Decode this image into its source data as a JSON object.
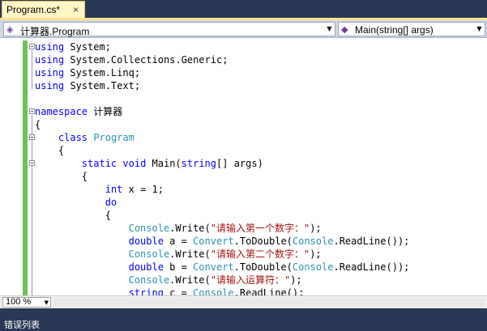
{
  "tab": {
    "title": "Program.cs*",
    "close": "×"
  },
  "navigation": {
    "type_combo": {
      "icon": "class-icon",
      "icon_glyph": "◈",
      "value": "计算器.Program",
      "arrow": "▼"
    },
    "member_combo": {
      "icon": "method-icon",
      "icon_glyph": "◆",
      "value": "Main(string[] args)",
      "arrow": "▼"
    }
  },
  "code": {
    "l1": {
      "kw": "using",
      "rest": " System;"
    },
    "l2": {
      "kw": "using",
      "rest": " System.Collections.Generic;"
    },
    "l3": {
      "kw": "using",
      "rest": " System.Linq;"
    },
    "l4": {
      "kw": "using",
      "rest": " System.Text;"
    },
    "l6": {
      "kw": "namespace",
      "rest": " 计算器"
    },
    "l7": {
      "text": "{"
    },
    "l8": {
      "indent": "    ",
      "kw": "class",
      "ty": "Program"
    },
    "l9": {
      "text": "    {"
    },
    "l10": {
      "indent": "        ",
      "kw1": "static",
      "kw2": "void",
      "name": "Main(",
      "kw3": "string",
      "rest": "[] args)"
    },
    "l11": {
      "text": "        {"
    },
    "l12": {
      "indent": "            ",
      "kw": "int",
      "rest": " x = 1;"
    },
    "l13": {
      "indent": "            ",
      "kw": "do"
    },
    "l14": {
      "text": "            {"
    },
    "l15": {
      "indent": "                ",
      "ty": "Console",
      "mid": ".Write(",
      "str": "\"请输入第一个数字：\"",
      "end": ");"
    },
    "l16": {
      "indent": "                ",
      "kw": "double",
      "pre": " a = ",
      "ty1": "Convert",
      "mid": ".ToDouble(",
      "ty2": "Console",
      "end": ".ReadLine());"
    },
    "l17": {
      "indent": "                ",
      "ty": "Console",
      "mid": ".Write(",
      "str": "\"请输入第二个数字：\"",
      "end": ");"
    },
    "l18": {
      "indent": "                ",
      "kw": "double",
      "pre": " b = ",
      "ty1": "Convert",
      "mid": ".ToDouble(",
      "ty2": "Console",
      "end": ".ReadLine());"
    },
    "l19": {
      "indent": "                ",
      "ty": "Console",
      "mid": ".Write(",
      "str": "\"请输入运算符：\"",
      "end": ");"
    },
    "l20": {
      "indent": "                ",
      "kw": "string",
      "pre": " c = ",
      "ty": "Console",
      "end": ".ReadLine();"
    }
  },
  "zoom": {
    "value": "100 %",
    "arrow": "▼"
  },
  "bottom_panel": {
    "label": "错误列表"
  },
  "colors": {
    "keyword": "#0000ff",
    "type": "#2b91af",
    "string": "#a31515",
    "change_bar": "#6ac259",
    "tab_active": "#fff6c5",
    "frame": "#293955"
  }
}
